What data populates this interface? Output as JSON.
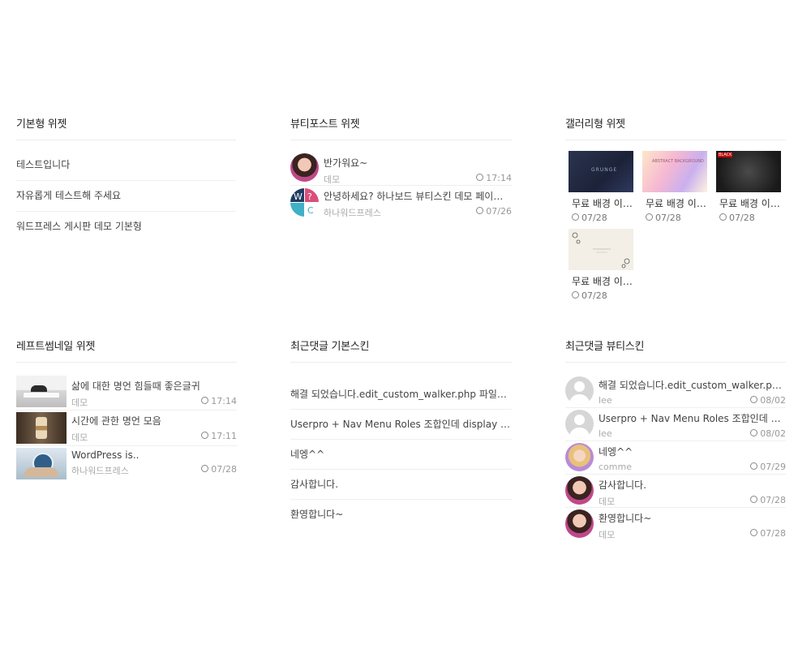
{
  "basic_widget": {
    "title": "기본형 위젯",
    "items": [
      "테스트입니다",
      "자유롭게 테스트해 주세요",
      "워드프레스 게시판 데모 기본형"
    ]
  },
  "beauty_post_widget": {
    "title": "뷰티포스트 위젯",
    "items": [
      {
        "title": "반가워요~",
        "author": "데모",
        "date": "17:14"
      },
      {
        "title": "안녕하세요? 하나보드 뷰티스킨 데모 페이지…",
        "author": "하나워드프레스",
        "date": "07/26"
      }
    ]
  },
  "gallery_widget": {
    "title": "갤러리형 위젯",
    "items": [
      {
        "caption": "무료 배경 이…",
        "date": "07/28",
        "label": "GRUNGE"
      },
      {
        "caption": "무료 배경 이…",
        "date": "07/28",
        "label": "ABSTRACT BACKGROUND"
      },
      {
        "caption": "무료 배경 이…",
        "date": "07/28",
        "label": "BLACK"
      },
      {
        "caption": "무료 배경 이…",
        "date": "07/28",
        "label": ""
      }
    ]
  },
  "left_thumb_widget": {
    "title": "레프트썸네일 위젯",
    "items": [
      {
        "title": "삶에 대한 명언 힘들때 좋은글귀",
        "author": "데모",
        "date": "17:14"
      },
      {
        "title": "시간에 관한 명언 모음",
        "author": "데모",
        "date": "17:11"
      },
      {
        "title": "WordPress is..",
        "author": "하나워드프레스",
        "date": "07/28"
      }
    ]
  },
  "recent_comments_basic": {
    "title": "최근댓글 기본스킨",
    "items": [
      "해결 되었습니다.edit_custom_walker.php 파일…",
      "Userpro + Nav Menu Roles 조합인데 display m…",
      "네엥^^",
      "감사합니다.",
      "환영합니다~"
    ]
  },
  "recent_comments_beauty": {
    "title": "최근댓글 뷰티스킨",
    "items": [
      {
        "text": "해결 되었습니다.edit_custom_walker.php …",
        "author": "lee",
        "date": "08/02",
        "avatar": "default"
      },
      {
        "text": "Userpro + Nav Menu Roles 조합인데 displ…",
        "author": "lee",
        "date": "08/02",
        "avatar": "default"
      },
      {
        "text": "네엥^^",
        "author": "comme",
        "date": "07/29",
        "avatar": "photo-blonde"
      },
      {
        "text": "감사합니다.",
        "author": "데모",
        "date": "07/28",
        "avatar": "photo-woman"
      },
      {
        "text": "환영합니다~",
        "author": "데모",
        "date": "07/28",
        "avatar": "photo-woman"
      }
    ]
  }
}
